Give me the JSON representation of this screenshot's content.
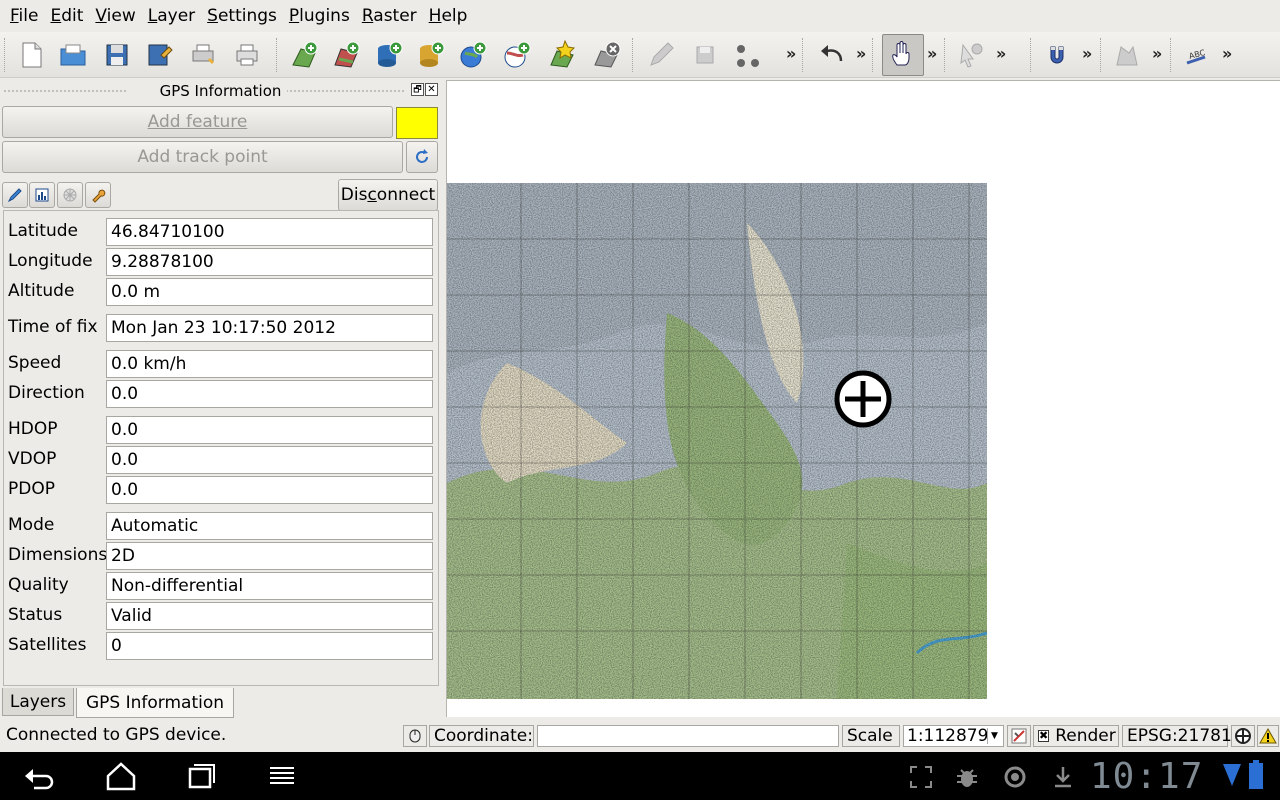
{
  "menu": [
    "File",
    "Edit",
    "View",
    "Layer",
    "Settings",
    "Plugins",
    "Raster",
    "Help"
  ],
  "toolbar": {
    "overflow": "»"
  },
  "dock": {
    "title": "GPS Information",
    "float_glyph": "🗗",
    "close_glyph": "✕",
    "add_feature_label": "Add feature",
    "add_track_point_label": "Add track point",
    "disconnect_label": "Disconnect",
    "feature_color": "#ffff00"
  },
  "gps": {
    "fields": [
      {
        "label": "Latitude",
        "value": "46.84710100"
      },
      {
        "label": "Longitude",
        "value": "9.28878100"
      },
      {
        "label": "Altitude",
        "value": "0.0 m"
      },
      {
        "label": "Time of fix",
        "value": "Mon Jan 23 10:17:50 2012"
      },
      {
        "label": "Speed",
        "value": "0.0 km/h"
      },
      {
        "label": "Direction",
        "value": "0.0"
      },
      {
        "label": "HDOP",
        "value": "0.0"
      },
      {
        "label": "VDOP",
        "value": "0.0"
      },
      {
        "label": "PDOP",
        "value": "0.0"
      },
      {
        "label": "Mode",
        "value": "Automatic"
      },
      {
        "label": "Dimensions",
        "value": "2D"
      },
      {
        "label": "Quality",
        "value": "Non-differential"
      },
      {
        "label": "Status",
        "value": "Valid"
      },
      {
        "label": "Satellites",
        "value": "0"
      }
    ]
  },
  "tabs": [
    {
      "label": "Layers",
      "active": false
    },
    {
      "label": "GPS Information",
      "active": true
    }
  ],
  "status": {
    "message": "Connected to GPS device.",
    "coordinate_label": "Coordinate:",
    "coordinate_value": "",
    "scale_label": "Scale",
    "scale_value": "1:112879",
    "render_label": "Render",
    "render_checked": true,
    "crs": "EPSG:21781"
  },
  "system": {
    "time": "10:17"
  }
}
